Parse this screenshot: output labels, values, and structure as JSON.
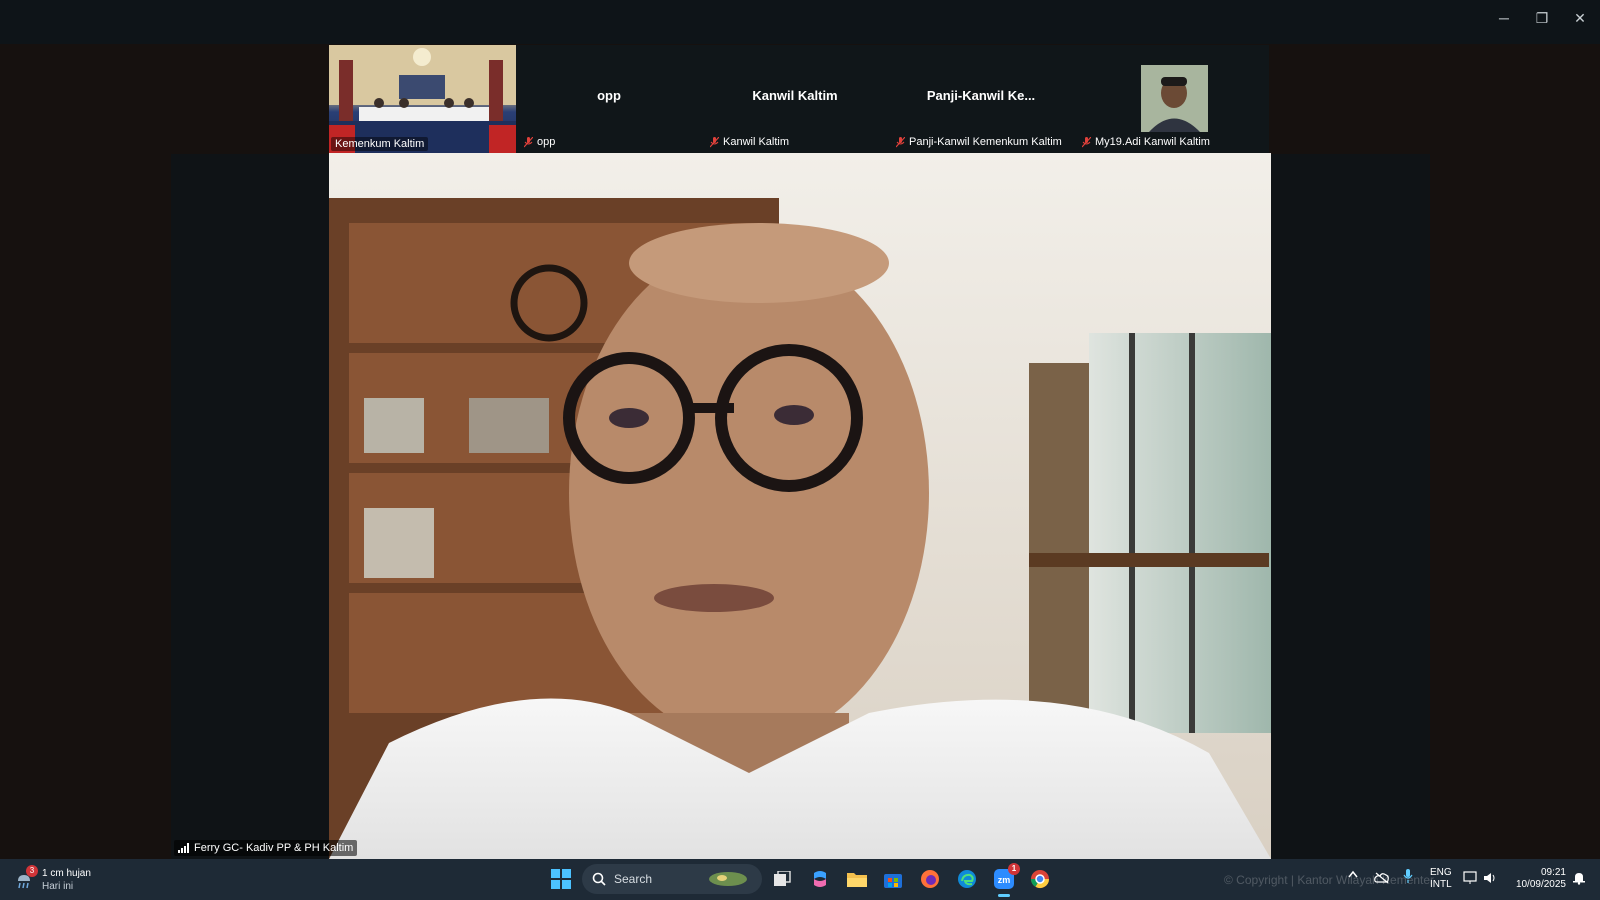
{
  "window": {
    "minimize_icon": "─",
    "restore_icon": "❐",
    "close_icon": "✕"
  },
  "gallery": {
    "tiles": [
      {
        "name": "",
        "label": "Kemenkum Kaltim",
        "type": "video",
        "muted": false
      },
      {
        "name": "opp",
        "label": "opp",
        "type": "name",
        "muted": true
      },
      {
        "name": "Kanwil Kaltim",
        "label": "Kanwil Kaltim",
        "type": "name",
        "muted": true
      },
      {
        "name": "Panji-Kanwil  Ke...",
        "label": "Panji-Kanwil Kemenkum Kaltim",
        "type": "name",
        "muted": true
      },
      {
        "name": "",
        "label": "My19.Adi Kanwil Kaltim",
        "type": "avatar",
        "muted": true
      }
    ]
  },
  "speaker": {
    "label": "Ferry GC- Kadiv PP & PH Kaltim",
    "signal_icon": "signal-bars-icon"
  },
  "taskbar": {
    "weather": {
      "badge": "3",
      "line1": "1 cm hujan",
      "line2": "Hari ini"
    },
    "search_placeholder": "Search",
    "apps": [
      "start-icon",
      "task-view-icon",
      "copilot-icon",
      "file-explorer-icon",
      "store-icon",
      "firefox-icon",
      "edge-icon",
      "zoom-icon",
      "chrome-icon"
    ],
    "zoom_badge": "1",
    "watermark": "© Copyright | Kantor Wilayah Kementerian Hukum Kalimantan Timur",
    "language": {
      "line1": "ENG",
      "line2": "INTL"
    },
    "clock": {
      "time": "09:21",
      "date": "10/09/2025"
    }
  },
  "colors": {
    "titlebar": "#0e1418",
    "stage": "#16110f",
    "taskbar": "#1e2a36",
    "muted_red": "#e0413b",
    "zoom_blue": "#2d8cff"
  }
}
